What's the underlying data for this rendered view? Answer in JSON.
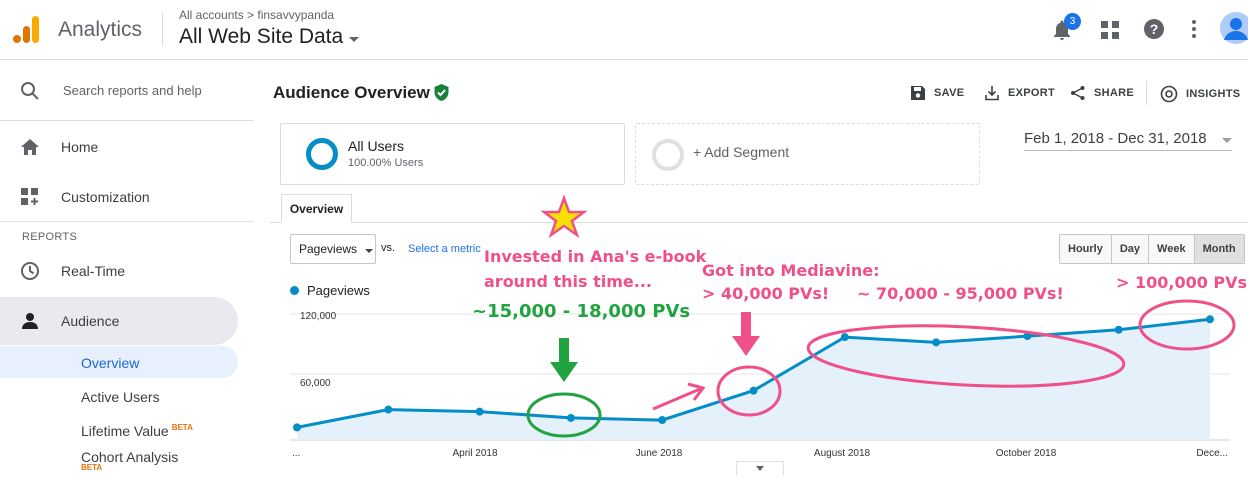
{
  "header": {
    "app_name": "Analytics",
    "account_crumb": "All accounts > finsavvypanda",
    "view_name": "All Web Site Data",
    "notification_count": "3"
  },
  "sidebar": {
    "search_placeholder": "Search reports and help",
    "home_label": "Home",
    "customization_label": "Customization",
    "reports_section": "REPORTS",
    "realtime_label": "Real-Time",
    "audience_label": "Audience",
    "sub_items": [
      {
        "label": "Overview"
      },
      {
        "label": "Active Users"
      },
      {
        "label": "Lifetime Value",
        "badge": "BETA"
      },
      {
        "label": "Cohort Analysis",
        "badge": "BETA"
      }
    ]
  },
  "main": {
    "title": "Audience Overview",
    "actions": {
      "save": "SAVE",
      "export": "EXPORT",
      "share": "SHARE",
      "insights": "INSIGHTS"
    },
    "segment": {
      "name": "All Users",
      "sub": "100.00% Users"
    },
    "add_segment": "+ Add Segment",
    "date_range": "Feb 1, 2018 - Dec 31, 2018",
    "tab_overview": "Overview",
    "metric_select": "Pageviews",
    "vs_label": "vs.",
    "select_metric": "Select a metric",
    "granularity": [
      "Hourly",
      "Day",
      "Week",
      "Month"
    ],
    "legend_label": "Pageviews"
  },
  "chart_data": {
    "type": "area",
    "series": [
      {
        "name": "Pageviews",
        "values": [
          12000,
          29000,
          27000,
          21000,
          19000,
          47000,
          98000,
          93000,
          99000,
          105000,
          115000
        ]
      }
    ],
    "x_labels": [
      "...",
      "April 2018",
      "June 2018",
      "August 2018",
      "October 2018",
      "Dece..."
    ],
    "y_ticks": [
      "120,000",
      "60,000"
    ],
    "ylim": [
      0,
      120000
    ],
    "color": "#058dc7"
  },
  "annotations": {
    "ebook_1": "Invested in Ana's e-book",
    "ebook_2": "around this time...",
    "ebook_range": "~15,000 - 18,000 PVs",
    "mediavine_1": "Got into Mediavine:",
    "mediavine_2": "> 40,000 PVs!",
    "range_70": "~ 70,000 - 95,000 PVs!",
    "over_100": "> 100,000 PVs!"
  }
}
